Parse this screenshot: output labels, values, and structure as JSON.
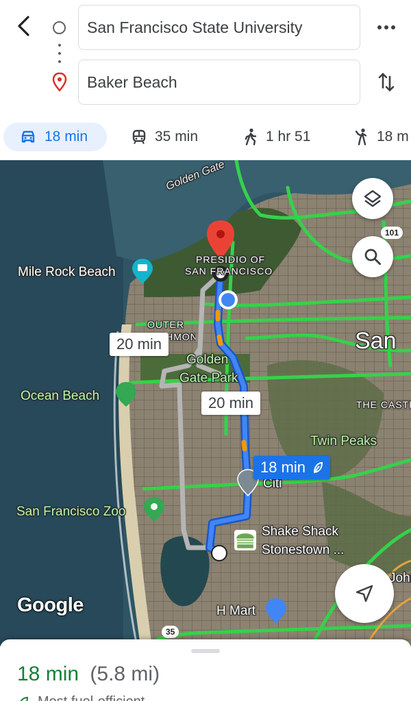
{
  "search": {
    "origin": "San Francisco State University",
    "destination": "Baker Beach"
  },
  "modes": [
    {
      "mode": "drive",
      "label": "18 min",
      "active": true
    },
    {
      "mode": "transit",
      "label": "35 min",
      "active": false
    },
    {
      "mode": "walk",
      "label": "1 hr 51",
      "active": false
    },
    {
      "mode": "ride",
      "label": "18 m",
      "active": false
    }
  ],
  "map": {
    "labels": {
      "golden_gate": "Golden Gate",
      "presidio": "PRESIDIO OF",
      "presidio2": "SAN FRANCISCO",
      "mile_rock": "Mile Rock Beach",
      "outer": "OUTER",
      "richmond": "RICHMOND",
      "golden_gate_park": "Golden",
      "golden_gate_park2": "Gate Park",
      "ocean_beach": "Ocean Beach",
      "san": "San",
      "castro": "THE CASTRO",
      "twin_peaks": "Twin Peaks",
      "citi": "Citi",
      "zoo": "San Francisco Zoo",
      "shake_shack": "Shake Shack",
      "stonestown": "Stonestown ...",
      "hmart": "H Mart",
      "john": "John",
      "hwy101": "101",
      "hwy35": "35"
    },
    "route_tags": {
      "alt1": "20 min",
      "alt2": "20 min",
      "best": "18 min"
    },
    "logo": "Google"
  },
  "summary": {
    "time": "18 min",
    "distance": "(5.8 mi)",
    "note": "Most fuel-efficient"
  },
  "colors": {
    "accent": "#1a73e8",
    "route": "#4285f4",
    "time_green": "#188038",
    "road": "#35d24a"
  }
}
